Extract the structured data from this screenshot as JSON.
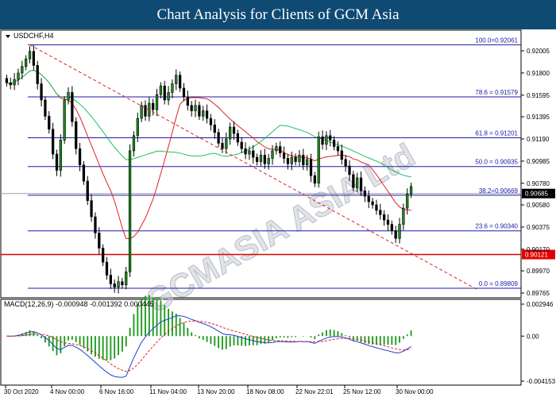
{
  "header": {
    "title": "Chart Analysis for Clients of GCM Asia"
  },
  "chart_data": {
    "type": "candlestick",
    "symbol_label": "USDCHF,H4",
    "watermark": "GCMASIA ASIA Ltd",
    "price_axis": {
      "ylim": [
        0.89765,
        0.92175
      ],
      "tick_labels": [
        "0.92005",
        "0.91800",
        "0.91595",
        "0.91395",
        "0.91190",
        "0.90985",
        "0.90780",
        "0.90580",
        "0.90375",
        "0.90170",
        "0.89970",
        "0.89765"
      ],
      "tick_values": [
        0.92005,
        0.918,
        0.91595,
        0.91395,
        0.9119,
        0.90985,
        0.9078,
        0.9058,
        0.90375,
        0.9017,
        0.8997,
        0.89765
      ]
    },
    "current_price": {
      "label": "0.90685",
      "value": 0.90685
    },
    "horizontal_level": {
      "label": "0.90121",
      "value": 0.90121,
      "color": "#e00000"
    },
    "fibonacci": [
      {
        "label": "100.0=0.92061",
        "value": 0.92061
      },
      {
        "label": "78.6 = 0.91579",
        "value": 0.91579
      },
      {
        "label": "61.8 = 0.91201",
        "value": 0.91201
      },
      {
        "label": "50.0 = 0.90935",
        "value": 0.90935
      },
      {
        "label": "38.2=0.90669",
        "value": 0.90669
      },
      {
        "label": "23.6 = 0.90340",
        "value": 0.9034
      },
      {
        "label": "0.0 = 0.89809",
        "value": 0.89809
      }
    ],
    "x_axis_labels": [
      "30 Oct 2020",
      "4 Nov 00:00",
      "6 Nov 16:00",
      "11 Nov 04:00",
      "13 Nov 20:00",
      "18 Nov 08:00",
      "22 Nov 22:01",
      "25 Nov 12:00",
      "30 Nov 00:00"
    ],
    "closes": [
      0.9171,
      0.9169,
      0.9174,
      0.918,
      0.9186,
      0.9193,
      0.92,
      0.9187,
      0.917,
      0.9155,
      0.914,
      0.9128,
      0.9105,
      0.909,
      0.9118,
      0.9155,
      0.9162,
      0.9135,
      0.911,
      0.9095,
      0.908,
      0.9062,
      0.9047,
      0.9032,
      0.9018,
      0.9005,
      0.8993,
      0.8985,
      0.8982,
      0.8987,
      0.8984,
      0.8996,
      0.9108,
      0.9122,
      0.9138,
      0.915,
      0.914,
      0.9152,
      0.9146,
      0.916,
      0.9168,
      0.9155,
      0.9162,
      0.917,
      0.9178,
      0.9166,
      0.9158,
      0.915,
      0.9145,
      0.915,
      0.914,
      0.9145,
      0.9138,
      0.9132,
      0.9125,
      0.9115,
      0.911,
      0.9119,
      0.913,
      0.9124,
      0.9116,
      0.911,
      0.9105,
      0.9108,
      0.9102,
      0.9098,
      0.9104,
      0.9096,
      0.9101,
      0.9108,
      0.9112,
      0.9106,
      0.9101,
      0.9096,
      0.9102,
      0.9098,
      0.9104,
      0.9095,
      0.91,
      0.9085,
      0.9078,
      0.9121,
      0.9114,
      0.9122,
      0.9118,
      0.9112,
      0.9108,
      0.91,
      0.9094,
      0.9086,
      0.9074,
      0.9083,
      0.9071,
      0.9066,
      0.9061,
      0.9058,
      0.9053,
      0.9049,
      0.9044,
      0.904,
      0.9034,
      0.9027,
      0.904,
      0.9055,
      0.9068,
      0.9075
    ],
    "ma_red_label": "",
    "ma_green_label": "",
    "macd": {
      "label": "MACD(12,26,9) -0.000948 -0.001392 0.000445",
      "ylim": [
        -0.004153,
        0.002946
      ],
      "tick_labels": [
        "0.002946",
        "0.00",
        "-0.004153"
      ],
      "tick_values": [
        0.002946,
        0.0,
        -0.004153
      ]
    }
  }
}
